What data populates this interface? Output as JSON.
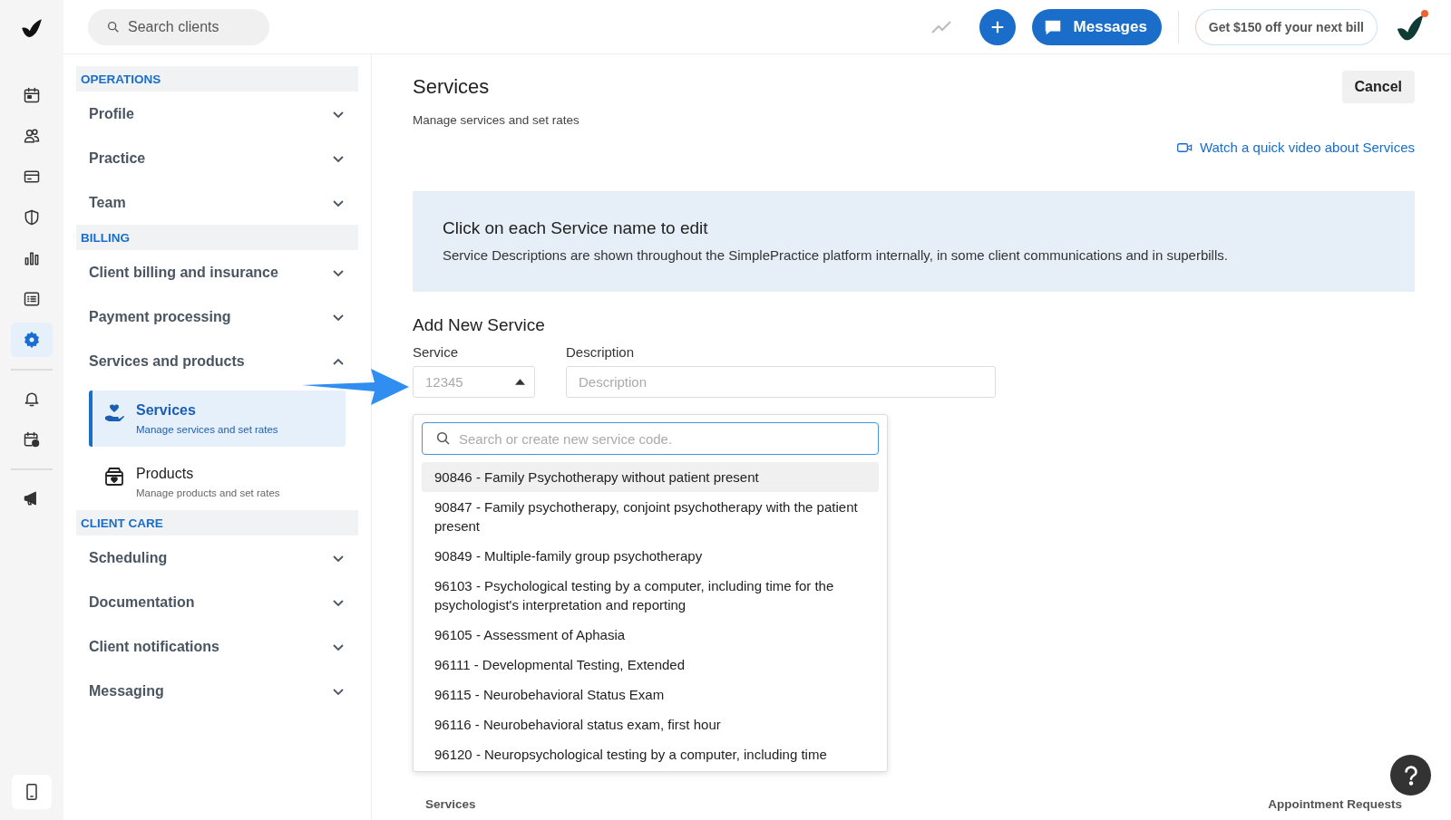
{
  "topbar": {
    "search_placeholder": "Search clients",
    "messages_label": "Messages",
    "promo": "Get $150 off your next bill",
    "has_notification": true
  },
  "rail": [
    {
      "selected": false
    },
    {
      "selected": false
    },
    {
      "selected": false
    },
    {
      "selected": false
    },
    {
      "selected": false
    },
    {
      "selected": false
    },
    {
      "selected": true
    },
    {
      "selected": false
    },
    {
      "selected": false
    },
    {
      "selected": false
    }
  ],
  "sidebar": {
    "sections": [
      {
        "title": "OPERATIONS",
        "items": [
          {
            "label": "Profile",
            "expanded": false
          },
          {
            "label": "Practice",
            "expanded": false
          },
          {
            "label": "Team",
            "expanded": false
          }
        ]
      },
      {
        "title": "BILLING",
        "items": [
          {
            "label": "Client billing and insurance",
            "expanded": false
          },
          {
            "label": "Payment processing",
            "expanded": false
          },
          {
            "label": "Services and products",
            "expanded": true,
            "children": [
              {
                "title": "Services",
                "subtitle": "Manage services and set rates",
                "selected": true
              },
              {
                "title": "Products",
                "subtitle": "Manage products and set rates",
                "selected": false
              }
            ]
          }
        ]
      },
      {
        "title": "CLIENT CARE",
        "items": [
          {
            "label": "Scheduling",
            "expanded": false
          },
          {
            "label": "Documentation",
            "expanded": false
          },
          {
            "label": "Client notifications",
            "expanded": false
          },
          {
            "label": "Messaging",
            "expanded": false
          }
        ]
      }
    ]
  },
  "page": {
    "title": "Services",
    "subtitle": "Manage services and set rates",
    "cancel": "Cancel",
    "video_link": "Watch a quick video about Services"
  },
  "banner": {
    "title": "Click on each Service name to edit",
    "text": "Service Descriptions are shown throughout the SimplePractice platform internally, in some client communications and in superbills."
  },
  "add_new": {
    "heading": "Add New Service",
    "service_label": "Service",
    "service_placeholder": "12345",
    "description_label": "Description",
    "description_placeholder": "Description"
  },
  "dropdown": {
    "open": true,
    "search_placeholder": "Search or create new service code.",
    "options": [
      {
        "label": "90846 - Family Psychotherapy without patient present",
        "selected": true
      },
      {
        "label": "90847 - Family psychotherapy, conjoint psychotherapy with the patient present",
        "selected": false
      },
      {
        "label": "90849 - Multiple-family group psychotherapy",
        "selected": false
      },
      {
        "label": "96103 - Psychological testing by a computer, including time for the psychologist's interpretation and reporting",
        "selected": false
      },
      {
        "label": "96105 - Assessment of Aphasia",
        "selected": false
      },
      {
        "label": "96111 - Developmental Testing, Extended",
        "selected": false
      },
      {
        "label": "96115 - Neurobehavioral Status Exam",
        "selected": false
      },
      {
        "label": "96116 - Neurobehavioral status exam, first hour",
        "selected": false
      },
      {
        "label": "96120 - Neuropsychological testing by a computer, including time",
        "selected": false
      }
    ]
  },
  "footer": {
    "left": "Services",
    "right": "Appointment Requests"
  }
}
